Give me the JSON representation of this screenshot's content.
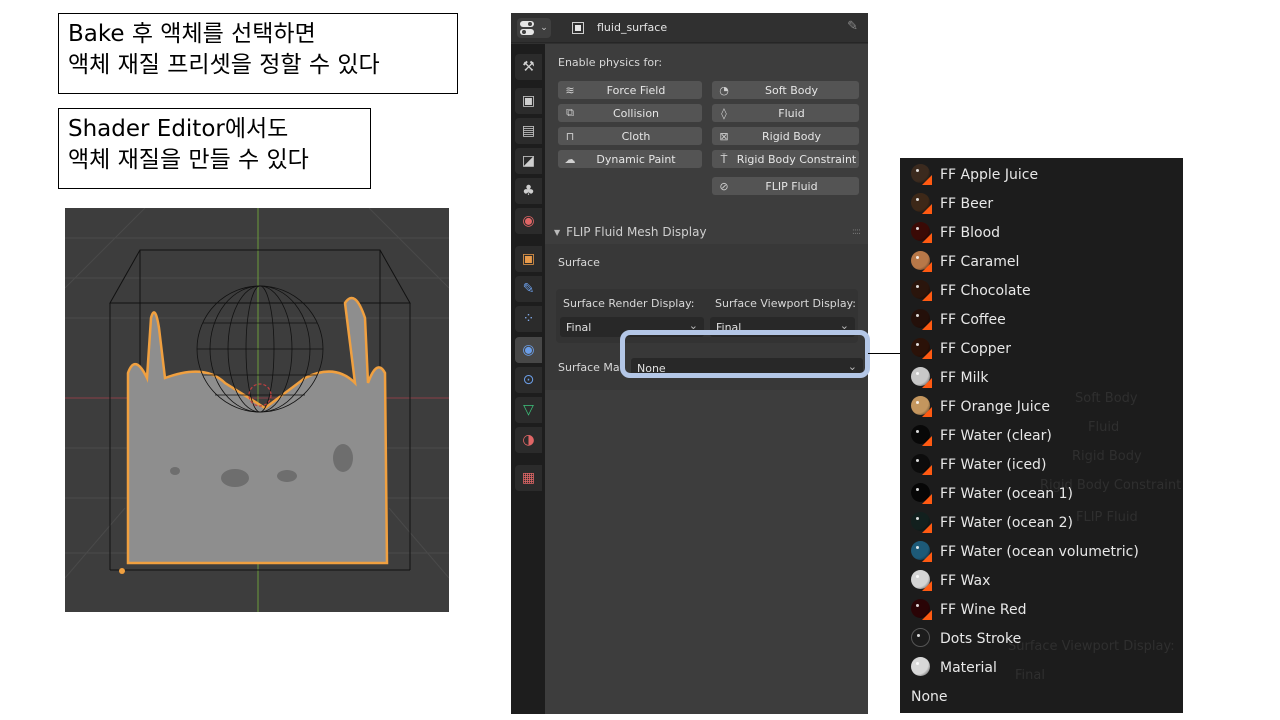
{
  "callouts": {
    "first": "Bake 후 액체를 선택하면\n액체 재질 프리셋을 정할 수 있다",
    "second": "Shader Editor에서도\n액체 재질을 만들 수 있다"
  },
  "properties": {
    "object_name": "fluid_surface",
    "enable_physics_label": "Enable physics for:",
    "physics_buttons": [
      {
        "label": "Force Field",
        "icon": "force-field-icon"
      },
      {
        "label": "Soft Body",
        "icon": "soft-body-icon"
      },
      {
        "label": "Collision",
        "icon": "collision-icon"
      },
      {
        "label": "Fluid",
        "icon": "fluid-drop-icon"
      },
      {
        "label": "Cloth",
        "icon": "cloth-icon"
      },
      {
        "label": "Rigid Body",
        "icon": "rigid-body-icon"
      },
      {
        "label": "Dynamic Paint",
        "icon": "dynamic-paint-icon"
      },
      {
        "label": "Rigid Body Constraint",
        "icon": "rigid-body-constraint-icon"
      },
      {
        "label": "FLIP Fluid",
        "icon": "flip-fluid-icon"
      }
    ],
    "subpanel_title": "FLIP Fluid Mesh Display",
    "surface_label": "Surface",
    "render_display_label": "Surface Render Display:",
    "render_display_value": "Final",
    "viewport_display_label": "Surface Viewport Display:",
    "viewport_display_value": "Final",
    "surface_material_label": "Surface Mat",
    "surface_material_value": "None",
    "tabs": [
      {
        "name": "tool",
        "color": "#cfcfcf"
      },
      {
        "name": "render",
        "color": "#cfcfcf"
      },
      {
        "name": "output",
        "color": "#cfcfcf"
      },
      {
        "name": "view-layer",
        "color": "#cfcfcf"
      },
      {
        "name": "scene",
        "color": "#cfcfcf"
      },
      {
        "name": "world",
        "color": "#e06666"
      },
      {
        "name": "object",
        "color": "#e89a4a"
      },
      {
        "name": "modifiers",
        "color": "#6b9ee8"
      },
      {
        "name": "particles",
        "color": "#7fa8e8"
      },
      {
        "name": "physics",
        "color": "#6b9ee8",
        "active": true
      },
      {
        "name": "constraints",
        "color": "#6b9ee8"
      },
      {
        "name": "data",
        "color": "#3dc17a"
      },
      {
        "name": "material",
        "color": "#e06666"
      },
      {
        "name": "texture",
        "color": "#e06666"
      }
    ]
  },
  "material_list": {
    "items": [
      {
        "label": "FF Apple Juice",
        "color": "#3b2a1e",
        "preview": true
      },
      {
        "label": "FF Beer",
        "color": "#3d2818",
        "preview": true
      },
      {
        "label": "FF Blood",
        "color": "#3a0a06",
        "preview": true
      },
      {
        "label": "FF Caramel",
        "color": "#b87848",
        "preview": true
      },
      {
        "label": "FF Chocolate",
        "color": "#2a150c",
        "preview": true
      },
      {
        "label": "FF Coffee",
        "color": "#24100a",
        "preview": true
      },
      {
        "label": "FF Copper",
        "color": "#2b1208",
        "preview": true
      },
      {
        "label": "FF Milk",
        "color": "#c8c8c8",
        "preview": true
      },
      {
        "label": "FF Orange Juice",
        "color": "#c4965e",
        "preview": true
      },
      {
        "label": "FF Water (clear)",
        "color": "#080808",
        "preview": true
      },
      {
        "label": "FF Water (iced)",
        "color": "#0c0c0c",
        "preview": true
      },
      {
        "label": "FF Water (ocean 1)",
        "color": "#060606",
        "preview": true
      },
      {
        "label": "FF Water (ocean 2)",
        "color": "#12201e",
        "preview": true
      },
      {
        "label": "FF Water (ocean volumetric)",
        "color": "#1d5a78",
        "preview": true
      },
      {
        "label": "FF Wax",
        "color": "#d4d4d4",
        "preview": true
      },
      {
        "label": "FF Wine Red",
        "color": "#2a0406",
        "preview": true
      },
      {
        "label": "Dots Stroke",
        "color": "#1c1c1c",
        "preview": false,
        "outline": true
      },
      {
        "label": "Material",
        "color": "#d8d8d8",
        "preview": false
      },
      {
        "label": "None",
        "color": null,
        "preview": false
      }
    ],
    "background_ghost": {
      "soft_body": "Soft Body",
      "fluid": "Fluid",
      "rigid_body": "Rigid Body",
      "rigid_body_constraint": "Rigid Body Constraint",
      "flip_fluid": "FLIP Fluid",
      "viewport_display": "Surface Viewport Display:",
      "final": "Final"
    }
  },
  "colors": {
    "highlight": "#b4c7e7",
    "selection_outline": "#f0a040",
    "material_corner": "#ff5a12"
  }
}
